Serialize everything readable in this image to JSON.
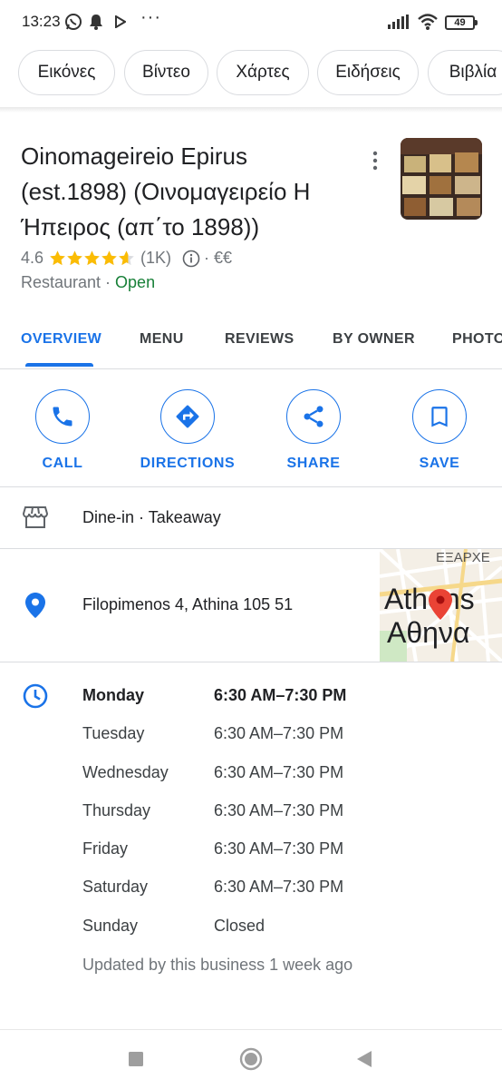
{
  "status_bar": {
    "time": "13:23",
    "battery": "49"
  },
  "chips": [
    "Εικόνες",
    "Βίντεο",
    "Χάρτες",
    "Ειδήσεις",
    "Βιβλία"
  ],
  "place": {
    "name": "Oinomageireio Epirus (est.1898) (Οινομαγειρείο Η Ήπειρος (απ΄το 1898))",
    "rating": "4.6",
    "stars": 4.6,
    "reviews": "(1K)",
    "price": "· €€",
    "category": "Restaurant · ",
    "open_status": "Open"
  },
  "tabs": [
    "OVERVIEW",
    "MENU",
    "REVIEWS",
    "BY OWNER",
    "PHOTOS"
  ],
  "actions": {
    "call": "CALL",
    "directions": "DIRECTIONS",
    "share": "SHARE",
    "save": "SAVE"
  },
  "service_options": "Dine-in · Takeaway",
  "address": "Filopimenos 4, Athina 105 51",
  "map": {
    "label_en": "Athens",
    "label_gr": "Αθηνα",
    "area": "ΕΞΑΡΧΕ"
  },
  "hours": [
    {
      "day": "Monday",
      "time": "6:30 AM–7:30 PM"
    },
    {
      "day": "Tuesday",
      "time": "6:30 AM–7:30 PM"
    },
    {
      "day": "Wednesday",
      "time": "6:30 AM–7:30 PM"
    },
    {
      "day": "Thursday",
      "time": "6:30 AM–7:30 PM"
    },
    {
      "day": "Friday",
      "time": "6:30 AM–7:30 PM"
    },
    {
      "day": "Saturday",
      "time": "6:30 AM–7:30 PM"
    },
    {
      "day": "Sunday",
      "time": "Closed"
    }
  ],
  "hours_updated": "Updated by this business 1 week ago",
  "colors": {
    "accent": "#1a73e8",
    "open": "#188038",
    "star": "#fbbc04",
    "pin": "#ea4335"
  }
}
